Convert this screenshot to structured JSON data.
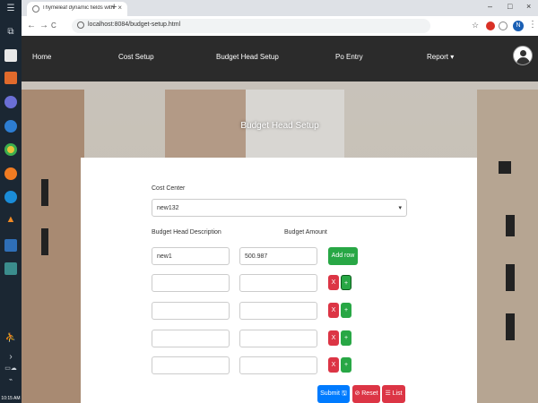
{
  "taskbar": {
    "clock": "10:15 AM"
  },
  "browser": {
    "tab_title": "Thymeleaf dynamic fields with u",
    "tab_close": "×",
    "new_tab": "+",
    "window_controls": [
      "–",
      "□",
      "×"
    ],
    "nav": [
      "←",
      "→",
      "C"
    ],
    "url": "localhost:8084/budget-setup.html",
    "profile_initial": "N",
    "star": "☆",
    "kebab": "⋮"
  },
  "navbar": {
    "items": [
      "Home",
      "Cost Setup",
      "Budget Head Setup",
      "Po Entry",
      "Report ▾"
    ]
  },
  "page": {
    "title": "Budget Head Setup"
  },
  "form": {
    "cost_center_label": "Cost Center",
    "cost_center_value": "new132",
    "select_caret": "▾",
    "description_label": "Budget Head Description",
    "amount_label": "Budget Amount",
    "add_row_label": "Add row",
    "rows": [
      {
        "description": "new1",
        "amount": "500.987"
      },
      {
        "description": "",
        "amount": ""
      },
      {
        "description": "",
        "amount": ""
      },
      {
        "description": "",
        "amount": ""
      },
      {
        "description": "",
        "amount": ""
      }
    ],
    "remove_label": "X",
    "add_label": "+",
    "submit_label": "Submit 🖫",
    "reset_label": "⊘ Reset",
    "list_label": "☰ List"
  },
  "colors": {
    "navbar": "#2b2b2b",
    "green": "#28a745",
    "red": "#dc3545",
    "blue": "#007bff"
  }
}
